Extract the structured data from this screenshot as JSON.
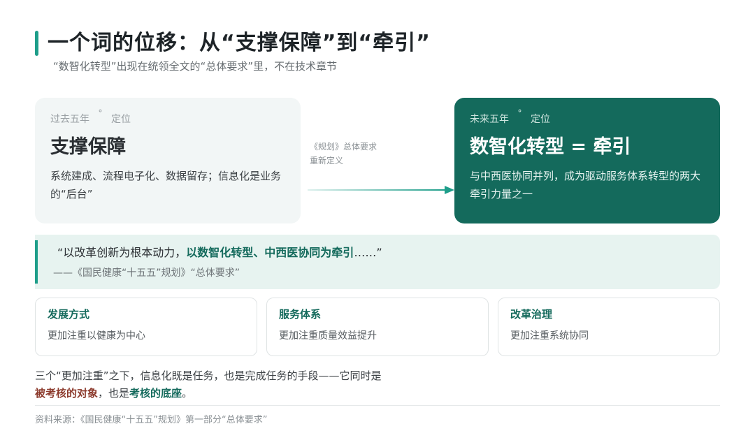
{
  "header": {
    "title": "一个词的位移：从“支撑保障”到“牵引”",
    "subtitle": "“数智化转型”出现在统领全文的“总体要求”里，不在技术章节"
  },
  "left_card": {
    "tag_a": "过去五年",
    "tag_sep": "˚",
    "tag_b": "定位",
    "heading": "支撑保障",
    "desc": "系统建成、流程电子化、数据留存；信息化是业务的“后台”"
  },
  "middle": {
    "line1": "《规划》总体要求",
    "line2": "重新定义"
  },
  "right_card": {
    "tag_a": "未来五年",
    "tag_sep": "˚",
    "tag_b": "定位",
    "heading": "数智化转型 = 牵引",
    "desc": "与中西医协同并列，成为驱动服务体系转型的两大牵引力量之一"
  },
  "quote": {
    "open": "“以改革创新为根本动力，",
    "strong": "以数智化转型、中西医协同为牵引",
    "close": "……”",
    "source": "——《国民健康“十五五”规划》“总体要求”"
  },
  "dimensions": [
    {
      "title": "发展方式",
      "desc": "更加注重以健康为中心"
    },
    {
      "title": "服务体系",
      "desc": "更加注重质量效益提升"
    },
    {
      "title": "改革治理",
      "desc": "更加注重系统协同"
    }
  ],
  "footer": {
    "line1": "三个“更加注重”之下，信息化既是任务，也是完成任务的手段——它同时是",
    "red": "被考核的对象",
    "mid": "，也是",
    "green": "考核的底座",
    "end": "。"
  },
  "source": "资料来源：《国民健康“十五五”规划》第一部分“总体要求”",
  "colors": {
    "accent": "#1e9e8a",
    "dark_green": "#146a5c",
    "light_green_bg": "#e7f3f0",
    "red": "#8c3a2c"
  }
}
